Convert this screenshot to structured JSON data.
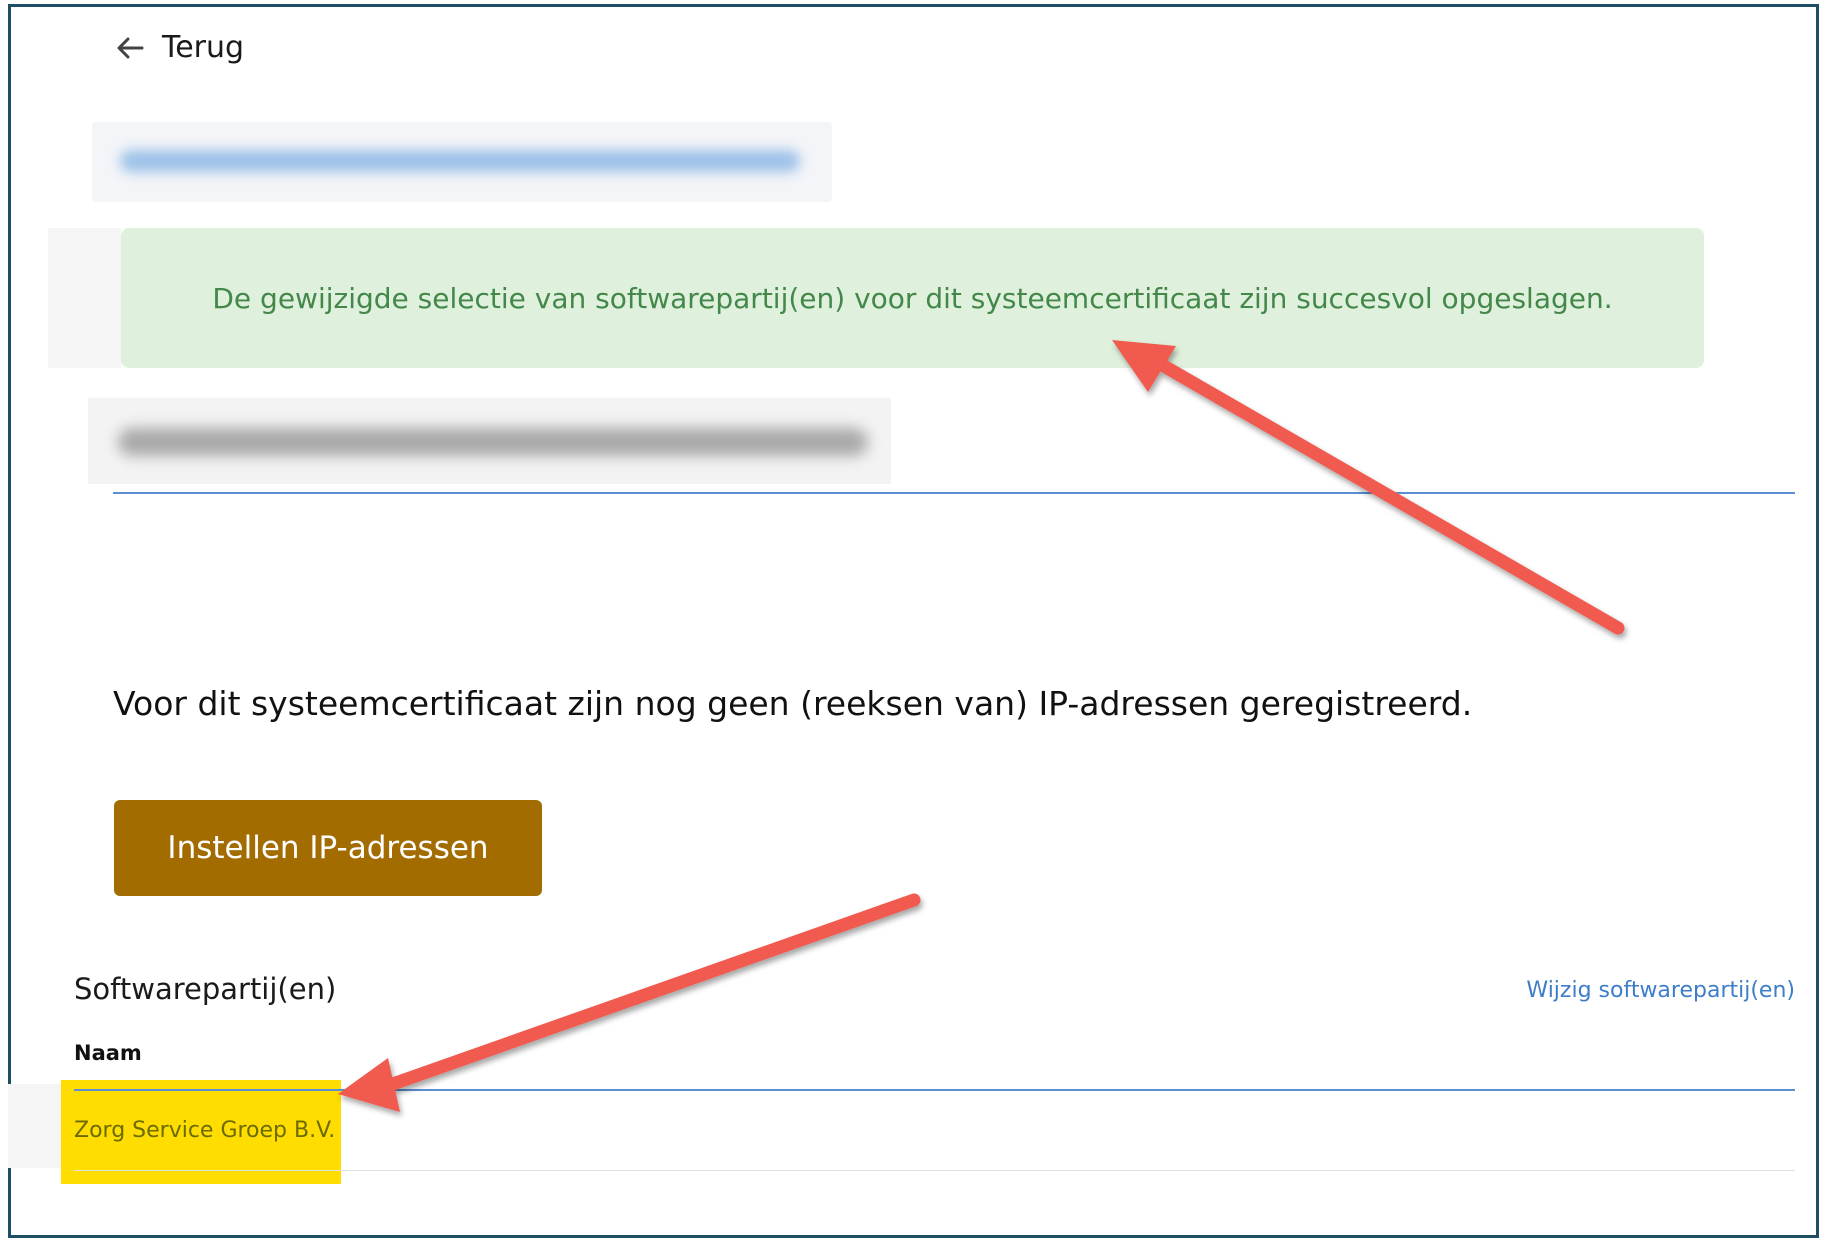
{
  "nav": {
    "back_label": "Terug"
  },
  "alert": {
    "message": "De gewijzigde selectie van softwarepartij(en) voor dit systeemcertificaat zijn succesvol opgeslagen.",
    "color": "#43884a",
    "background": "#dff1dc"
  },
  "ip_section": {
    "message": "Voor dit systeemcertificaat zijn nog geen (reeksen van) IP-adressen geregistreerd.",
    "button_label": "Instellen IP-adressen",
    "button_color": "#a36c00"
  },
  "software_section": {
    "title": "Softwarepartij(en)",
    "edit_link": "Wijzig softwarepartij(en)",
    "column_header": "Naam",
    "rows": [
      {
        "name": "Zorg Service Groep B.V."
      }
    ],
    "highlight_color": "#ffdd00"
  },
  "annotations": {
    "arrow_color": "#f05a4f",
    "icons": [
      "arrow-left-icon"
    ]
  }
}
